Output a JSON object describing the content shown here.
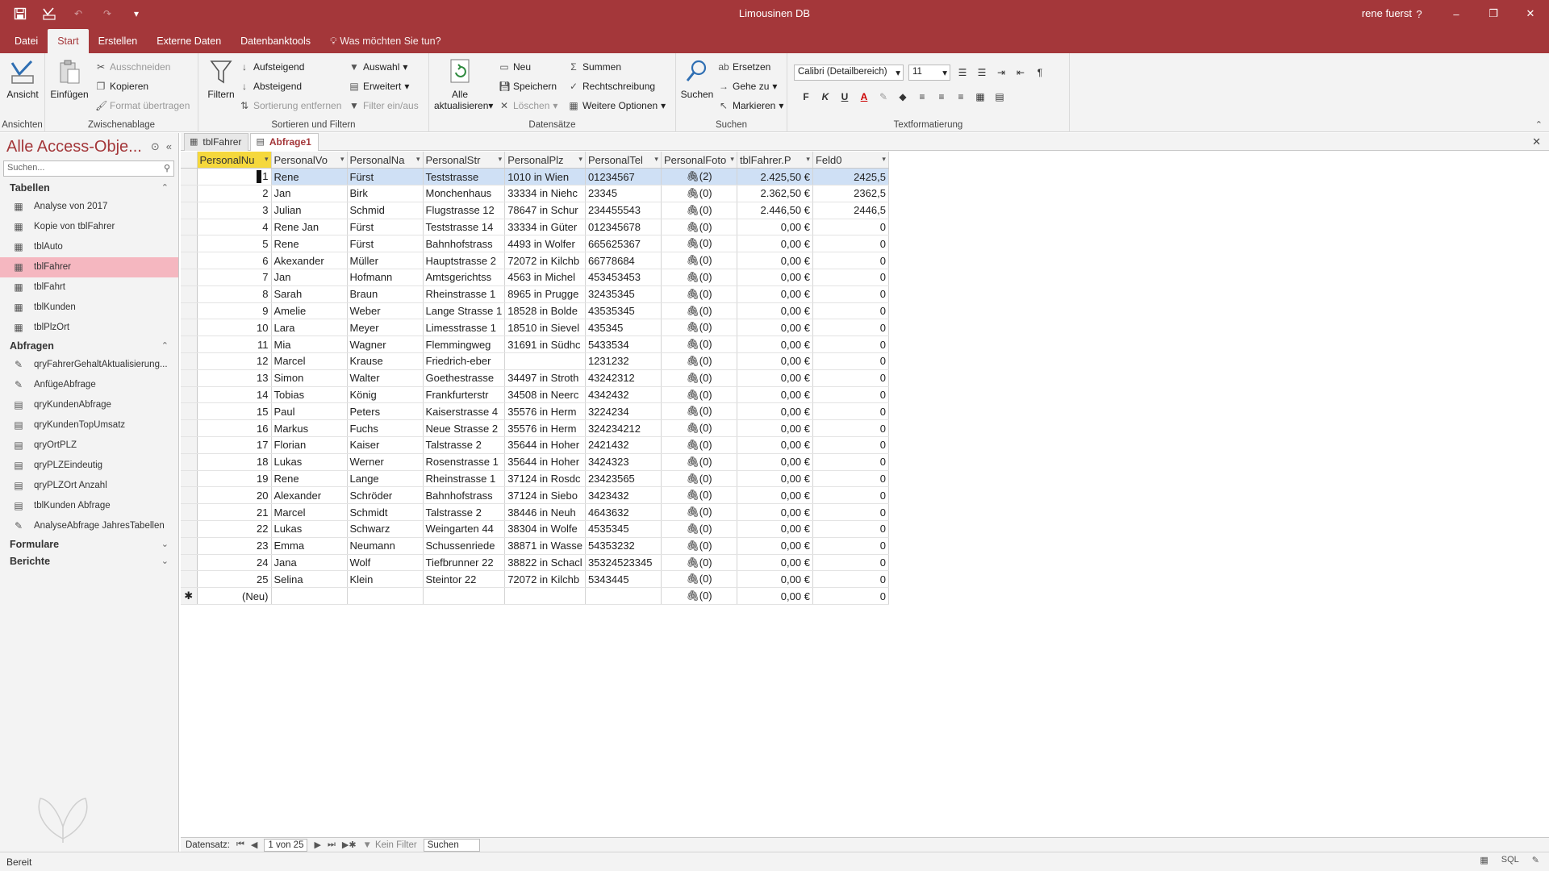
{
  "titlebar": {
    "title": "Limousinen DB",
    "user": "rene fuerst",
    "help": "?",
    "minimize": "–",
    "restore": "❐",
    "close": "✕"
  },
  "tabs": {
    "datei": "Datei",
    "start": "Start",
    "erstellen": "Erstellen",
    "externe": "Externe Daten",
    "datenbanktools": "Datenbanktools",
    "tell": "Was möchten Sie tun?"
  },
  "ribbon": {
    "ansicht": "Ansicht",
    "ansichten_group": "Ansichten",
    "einfuegen": "Einfügen",
    "ausschneiden": "Ausschneiden",
    "kopieren": "Kopieren",
    "format": "Format übertragen",
    "zwischenablage_group": "Zwischenablage",
    "filtern": "Filtern",
    "aufsteigend": "Aufsteigend",
    "absteigend": "Absteigend",
    "sortierung": "Sortierung entfernen",
    "auswahl": "Auswahl",
    "erweitert": "Erweitert",
    "filter_einaus": "Filter ein/aus",
    "sortieren_group": "Sortieren und Filtern",
    "alle": "Alle",
    "aktualisieren": "aktualisieren",
    "neu": "Neu",
    "speichern": "Speichern",
    "loeschen": "Löschen",
    "summen": "Summen",
    "rechtschreibung": "Rechtschreibung",
    "weitere": "Weitere Optionen",
    "datensaetze_group": "Datensätze",
    "suchen": "Suchen",
    "ersetzen": "Ersetzen",
    "gehezu": "Gehe zu",
    "markieren": "Markieren",
    "suchen_group": "Suchen",
    "font": "Calibri (Detailbereich)",
    "size": "11",
    "bold": "F",
    "italic": "K",
    "underline": "U",
    "textformat_group": "Textformatierung"
  },
  "nav": {
    "title": "Alle Access-Obje...",
    "search_placeholder": "Suchen...",
    "groups": {
      "tabellen": "Tabellen",
      "abfragen": "Abfragen",
      "formulare": "Formulare",
      "berichte": "Berichte"
    },
    "tables": [
      "Analyse von 2017",
      "Kopie von tblFahrer",
      "tblAuto",
      "tblFahrer",
      "tblFahrt",
      "tblKunden",
      "tblPlzOrt"
    ],
    "queries": [
      "qryFahrerGehaltAktualisierung...",
      "AnfügeAbfrage",
      "qryKundenAbfrage",
      "qryKundenTopUmsatz",
      "qryOrtPLZ",
      "qryPLZEindeutig",
      "qryPLZOrt Anzahl",
      "tblKunden Abfrage",
      "AnalyseAbfrage JahresTabellen"
    ]
  },
  "doctabs": {
    "tab1": "tblFahrer",
    "tab2": "Abfrage1"
  },
  "grid": {
    "headers": [
      "PersonalNu",
      "PersonalVo",
      "PersonalNa",
      "PersonalStr",
      "PersonalPlz",
      "PersonalTel",
      "PersonalFoto",
      "tblFahrer.P",
      "Feld0"
    ],
    "rows": [
      [
        "1",
        "Rene",
        "Fürst",
        "Teststrasse",
        "1010 in Wien",
        "01234567",
        "(2)",
        "2.425,50 €",
        "2425,5"
      ],
      [
        "2",
        "Jan",
        "Birk",
        "Monchenhaus",
        "33334 in Niehc",
        "23345",
        "(0)",
        "2.362,50 €",
        "2362,5"
      ],
      [
        "3",
        "Julian",
        "Schmid",
        "Flugstrasse 12",
        "78647 in Schur",
        "234455543",
        "(0)",
        "2.446,50 €",
        "2446,5"
      ],
      [
        "4",
        "Rene Jan",
        "Fürst",
        "Teststrasse 14",
        "33334 in Güter",
        "012345678",
        "(0)",
        "0,00 €",
        "0"
      ],
      [
        "5",
        "Rene",
        "Fürst",
        "Bahnhofstrass",
        "4493 in Wolfer",
        "665625367",
        "(0)",
        "0,00 €",
        "0"
      ],
      [
        "6",
        "Akexander",
        "Müller",
        "Hauptstrasse 2",
        "72072 in Kilchb",
        "66778684",
        "(0)",
        "0,00 €",
        "0"
      ],
      [
        "7",
        "Jan",
        "Hofmann",
        "Amtsgerichtss",
        "4563 in Michel",
        "453453453",
        "(0)",
        "0,00 €",
        "0"
      ],
      [
        "8",
        "Sarah",
        "Braun",
        "Rheinstrasse 1",
        "8965 in Prugge",
        "32435345",
        "(0)",
        "0,00 €",
        "0"
      ],
      [
        "9",
        "Amelie",
        "Weber",
        "Lange Strasse 1",
        "18528 in Bolde",
        "43535345",
        "(0)",
        "0,00 €",
        "0"
      ],
      [
        "10",
        "Lara",
        "Meyer",
        "Limesstrasse 1",
        "18510 in Sievel",
        "435345",
        "(0)",
        "0,00 €",
        "0"
      ],
      [
        "11",
        "Mia",
        "Wagner",
        "Flemmingweg",
        "31691 in Südhc",
        "5433534",
        "(0)",
        "0,00 €",
        "0"
      ],
      [
        "12",
        "Marcel",
        "Krause",
        "Friedrich-eber",
        "",
        "1231232",
        "(0)",
        "0,00 €",
        "0"
      ],
      [
        "13",
        "Simon",
        "Walter",
        "Goethestrasse",
        "34497 in Stroth",
        "43242312",
        "(0)",
        "0,00 €",
        "0"
      ],
      [
        "14",
        "Tobias",
        "König",
        "Frankfurterstr",
        "34508 in Neerc",
        "4342432",
        "(0)",
        "0,00 €",
        "0"
      ],
      [
        "15",
        "Paul",
        "Peters",
        "Kaiserstrasse 4",
        "35576 in Herm",
        "3224234",
        "(0)",
        "0,00 €",
        "0"
      ],
      [
        "16",
        "Markus",
        "Fuchs",
        "Neue Strasse 2",
        "35576 in Herm",
        "324234212",
        "(0)",
        "0,00 €",
        "0"
      ],
      [
        "17",
        "Florian",
        "Kaiser",
        "Talstrasse 2",
        "35644 in Hoher",
        "2421432",
        "(0)",
        "0,00 €",
        "0"
      ],
      [
        "18",
        "Lukas",
        "Werner",
        "Rosenstrasse 1",
        "35644 in Hoher",
        "3424323",
        "(0)",
        "0,00 €",
        "0"
      ],
      [
        "19",
        "Rene",
        "Lange",
        "Rheinstrasse 1",
        "37124 in Rosdc",
        "23423565",
        "(0)",
        "0,00 €",
        "0"
      ],
      [
        "20",
        "Alexander",
        "Schröder",
        "Bahnhofstrass",
        "37124 in Siebo",
        "3423432",
        "(0)",
        "0,00 €",
        "0"
      ],
      [
        "21",
        "Marcel",
        "Schmidt",
        "Talstrasse 2",
        "38446 in Neuh",
        "4643632",
        "(0)",
        "0,00 €",
        "0"
      ],
      [
        "22",
        "Lukas",
        "Schwarz",
        "Weingarten 44",
        "38304 in Wolfe",
        "4535345",
        "(0)",
        "0,00 €",
        "0"
      ],
      [
        "23",
        "Emma",
        "Neumann",
        "Schussenriede",
        "38871 in Wasse",
        "54353232",
        "(0)",
        "0,00 €",
        "0"
      ],
      [
        "24",
        "Jana",
        "Wolf",
        "Tiefbrunner 22",
        "38822 in Schacl",
        "35324523345",
        "(0)",
        "0,00 €",
        "0"
      ],
      [
        "25",
        "Selina",
        "Klein",
        "Steintor 22",
        "72072 in Kilchb",
        "5343445",
        "(0)",
        "0,00 €",
        "0"
      ]
    ],
    "newrow": {
      "marker": "✱",
      "label": "(Neu)",
      "foto": "(0)",
      "p": "0,00 €",
      "feld": "0"
    }
  },
  "recnav": {
    "label": "Datensatz:",
    "pos": "1 von 25",
    "filter": "Kein Filter",
    "search": "Suchen"
  },
  "status": {
    "text": "Bereit",
    "sql": "SQL"
  }
}
